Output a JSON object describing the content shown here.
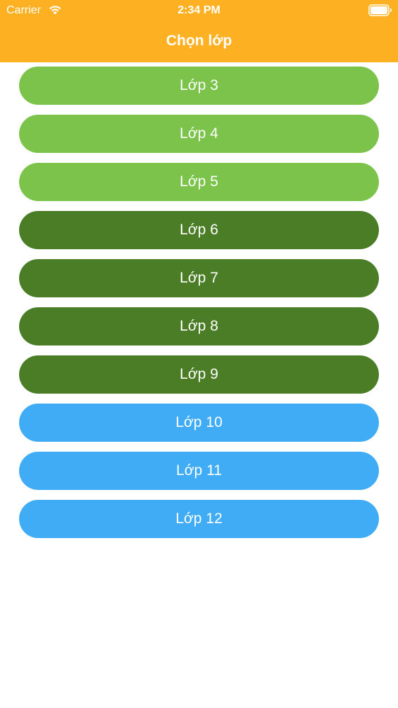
{
  "status_bar": {
    "carrier": "Carrier",
    "time": "2:34 PM"
  },
  "header": {
    "title": "Chọn lớp",
    "color": "#FDB122"
  },
  "grades": [
    {
      "label": "Lớp 3",
      "color": "#7BC34A"
    },
    {
      "label": "Lớp 4",
      "color": "#7BC34A"
    },
    {
      "label": "Lớp 5",
      "color": "#7BC34A"
    },
    {
      "label": "Lớp 6",
      "color": "#4A7D25"
    },
    {
      "label": "Lớp 7",
      "color": "#4A7D25"
    },
    {
      "label": "Lớp 8",
      "color": "#4A7D25"
    },
    {
      "label": "Lớp 9",
      "color": "#4A7D25"
    },
    {
      "label": "Lớp 10",
      "color": "#3FACF5"
    },
    {
      "label": "Lớp 11",
      "color": "#3FACF5"
    },
    {
      "label": "Lớp 12",
      "color": "#3FACF5"
    }
  ],
  "icons": {
    "wifi": "wifi-icon",
    "battery": "battery-icon"
  }
}
